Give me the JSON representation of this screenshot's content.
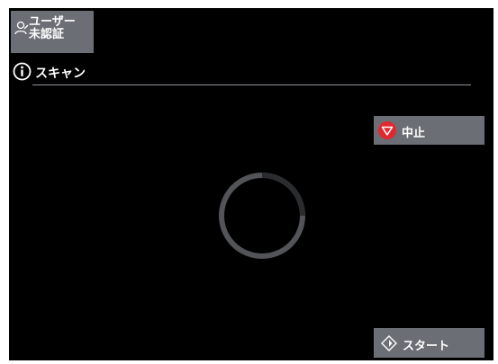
{
  "user": {
    "label": "ユーザー\n未認証",
    "icon": "user-icon"
  },
  "title": {
    "text": "スキャン",
    "icon": "info-icon"
  },
  "stop": {
    "label": "中止",
    "icon": "stop-icon",
    "icon_color": "#e0282e"
  },
  "start": {
    "label": "スタート",
    "icon": "start-diamond-icon"
  },
  "spinner": {
    "icon": "loading-spinner-icon"
  },
  "colors": {
    "background": "#000000",
    "button": "#6b6e75",
    "text": "#ffffff"
  }
}
